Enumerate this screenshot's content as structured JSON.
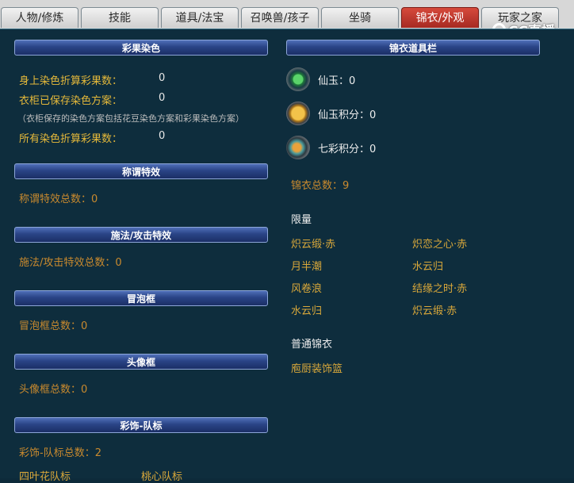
{
  "tabs": [
    "人物/修炼",
    "技能",
    "道具/法宝",
    "召唤兽/孩子",
    "坐骑",
    "锦衣/外观",
    "玩家之家"
  ],
  "logo": "CC直播",
  "left": {
    "dye": {
      "header": "彩果染色",
      "line1_label": "身上染色折算彩果数：",
      "line1_value": "0",
      "line2_label": "衣柜已保存染色方案：",
      "line2_value": "0",
      "note": "（衣柜保存的染色方案包括花豆染色方案和彩果染色方案）",
      "line3_label": "所有染色折算彩果数：",
      "line3_value": "0"
    },
    "title_effect": {
      "header": "称谓特效",
      "text": "称谓特效总数：0"
    },
    "cast_effect": {
      "header": "施法/攻击特效",
      "text": "施法/攻击特效总数：0"
    },
    "bubble": {
      "header": "冒泡框",
      "text": "冒泡框总数：0"
    },
    "avatar_frame": {
      "header": "头像框",
      "text": "头像框总数：0"
    },
    "team_flag": {
      "header": "彩饰-队标",
      "text": "彩饰-队标总数：2",
      "items": [
        "四叶花队标",
        "桃心队标"
      ]
    }
  },
  "right": {
    "header": "锦衣道具栏",
    "xianyu": "仙玉：0",
    "xianyu_points": "仙玉积分：0",
    "qicai_points": "七彩积分：0",
    "total": "锦衣总数：9",
    "limited_label": "限量",
    "limited_items": [
      "炽云缎·赤",
      "炽恋之心·赤",
      "月半潮",
      "水云归",
      "风卷浪",
      "结缘之时·赤",
      "水云归",
      "炽云缎·赤"
    ],
    "normal_label": "普通锦衣",
    "normal_items": [
      "庖厨装饰篮"
    ]
  },
  "colors": {
    "background": "#0e2d3d",
    "header": "#2a4486",
    "active_tab": "#c0392b",
    "label_yellow": "#e5b93a",
    "item_gold": "#d9a83a"
  }
}
